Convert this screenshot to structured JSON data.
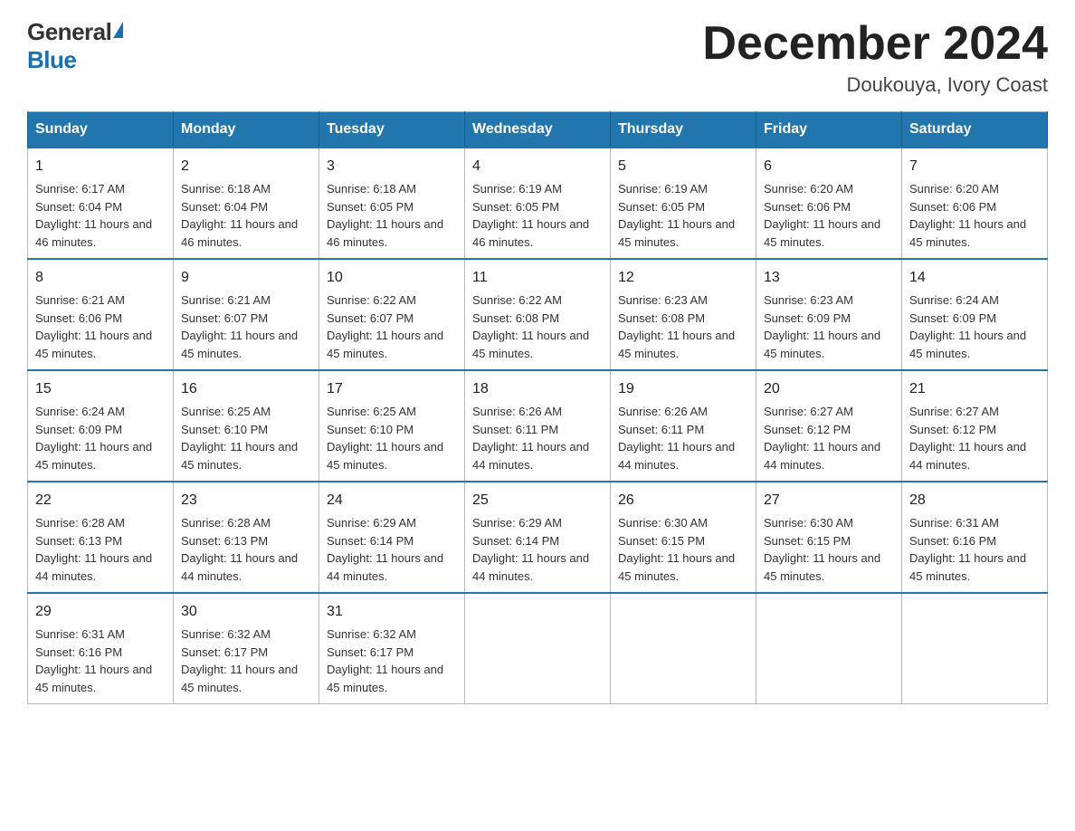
{
  "logo": {
    "general": "General",
    "blue": "Blue"
  },
  "title": {
    "month_year": "December 2024",
    "location": "Doukouya, Ivory Coast"
  },
  "headers": [
    "Sunday",
    "Monday",
    "Tuesday",
    "Wednesday",
    "Thursday",
    "Friday",
    "Saturday"
  ],
  "weeks": [
    [
      {
        "day": "1",
        "sunrise": "6:17 AM",
        "sunset": "6:04 PM",
        "daylight": "11 hours and 46 minutes."
      },
      {
        "day": "2",
        "sunrise": "6:18 AM",
        "sunset": "6:04 PM",
        "daylight": "11 hours and 46 minutes."
      },
      {
        "day": "3",
        "sunrise": "6:18 AM",
        "sunset": "6:05 PM",
        "daylight": "11 hours and 46 minutes."
      },
      {
        "day": "4",
        "sunrise": "6:19 AM",
        "sunset": "6:05 PM",
        "daylight": "11 hours and 46 minutes."
      },
      {
        "day": "5",
        "sunrise": "6:19 AM",
        "sunset": "6:05 PM",
        "daylight": "11 hours and 45 minutes."
      },
      {
        "day": "6",
        "sunrise": "6:20 AM",
        "sunset": "6:06 PM",
        "daylight": "11 hours and 45 minutes."
      },
      {
        "day": "7",
        "sunrise": "6:20 AM",
        "sunset": "6:06 PM",
        "daylight": "11 hours and 45 minutes."
      }
    ],
    [
      {
        "day": "8",
        "sunrise": "6:21 AM",
        "sunset": "6:06 PM",
        "daylight": "11 hours and 45 minutes."
      },
      {
        "day": "9",
        "sunrise": "6:21 AM",
        "sunset": "6:07 PM",
        "daylight": "11 hours and 45 minutes."
      },
      {
        "day": "10",
        "sunrise": "6:22 AM",
        "sunset": "6:07 PM",
        "daylight": "11 hours and 45 minutes."
      },
      {
        "day": "11",
        "sunrise": "6:22 AM",
        "sunset": "6:08 PM",
        "daylight": "11 hours and 45 minutes."
      },
      {
        "day": "12",
        "sunrise": "6:23 AM",
        "sunset": "6:08 PM",
        "daylight": "11 hours and 45 minutes."
      },
      {
        "day": "13",
        "sunrise": "6:23 AM",
        "sunset": "6:09 PM",
        "daylight": "11 hours and 45 minutes."
      },
      {
        "day": "14",
        "sunrise": "6:24 AM",
        "sunset": "6:09 PM",
        "daylight": "11 hours and 45 minutes."
      }
    ],
    [
      {
        "day": "15",
        "sunrise": "6:24 AM",
        "sunset": "6:09 PM",
        "daylight": "11 hours and 45 minutes."
      },
      {
        "day": "16",
        "sunrise": "6:25 AM",
        "sunset": "6:10 PM",
        "daylight": "11 hours and 45 minutes."
      },
      {
        "day": "17",
        "sunrise": "6:25 AM",
        "sunset": "6:10 PM",
        "daylight": "11 hours and 45 minutes."
      },
      {
        "day": "18",
        "sunrise": "6:26 AM",
        "sunset": "6:11 PM",
        "daylight": "11 hours and 44 minutes."
      },
      {
        "day": "19",
        "sunrise": "6:26 AM",
        "sunset": "6:11 PM",
        "daylight": "11 hours and 44 minutes."
      },
      {
        "day": "20",
        "sunrise": "6:27 AM",
        "sunset": "6:12 PM",
        "daylight": "11 hours and 44 minutes."
      },
      {
        "day": "21",
        "sunrise": "6:27 AM",
        "sunset": "6:12 PM",
        "daylight": "11 hours and 44 minutes."
      }
    ],
    [
      {
        "day": "22",
        "sunrise": "6:28 AM",
        "sunset": "6:13 PM",
        "daylight": "11 hours and 44 minutes."
      },
      {
        "day": "23",
        "sunrise": "6:28 AM",
        "sunset": "6:13 PM",
        "daylight": "11 hours and 44 minutes."
      },
      {
        "day": "24",
        "sunrise": "6:29 AM",
        "sunset": "6:14 PM",
        "daylight": "11 hours and 44 minutes."
      },
      {
        "day": "25",
        "sunrise": "6:29 AM",
        "sunset": "6:14 PM",
        "daylight": "11 hours and 44 minutes."
      },
      {
        "day": "26",
        "sunrise": "6:30 AM",
        "sunset": "6:15 PM",
        "daylight": "11 hours and 45 minutes."
      },
      {
        "day": "27",
        "sunrise": "6:30 AM",
        "sunset": "6:15 PM",
        "daylight": "11 hours and 45 minutes."
      },
      {
        "day": "28",
        "sunrise": "6:31 AM",
        "sunset": "6:16 PM",
        "daylight": "11 hours and 45 minutes."
      }
    ],
    [
      {
        "day": "29",
        "sunrise": "6:31 AM",
        "sunset": "6:16 PM",
        "daylight": "11 hours and 45 minutes."
      },
      {
        "day": "30",
        "sunrise": "6:32 AM",
        "sunset": "6:17 PM",
        "daylight": "11 hours and 45 minutes."
      },
      {
        "day": "31",
        "sunrise": "6:32 AM",
        "sunset": "6:17 PM",
        "daylight": "11 hours and 45 minutes."
      },
      null,
      null,
      null,
      null
    ]
  ]
}
